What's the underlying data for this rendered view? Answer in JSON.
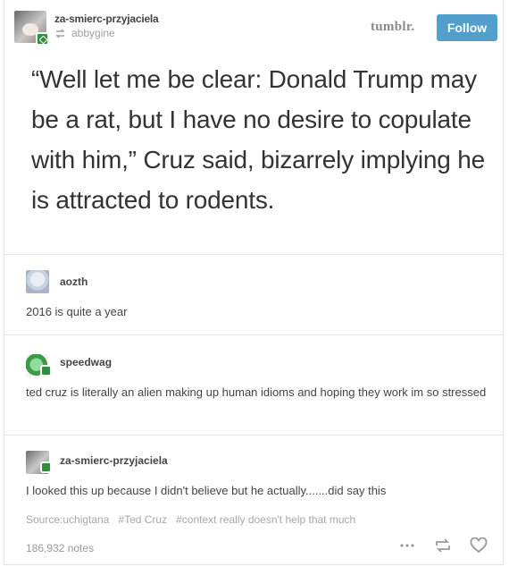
{
  "post": {
    "blog_name": "za-smierc-przyjaciela",
    "reblogged_from": "abbygine",
    "logo_text": "tumblr.",
    "follow_label": "Follow",
    "quote": "“Well let me be clear: Donald Trump may be a rat, but I have no desire to copulate with him,” Cruz said, bizarrely implying he is attracted to rodents."
  },
  "comments": [
    {
      "user": "aozth",
      "text": "2016 is quite a year"
    },
    {
      "user": "speedwag",
      "text": "ted cruz is literally an alien making up human idioms and hoping they work im so stressed"
    },
    {
      "user": "za-smierc-przyjaciela",
      "text": "I looked this up because I didn't believe but he actually.......did say this"
    }
  ],
  "tags": {
    "source": "Source:uchigtana",
    "tag1": "#Ted Cruz",
    "tag2": "#context really doesn't help that much"
  },
  "footer": {
    "notes": "186,932 notes",
    "icons": [
      "more-icon",
      "reblog-icon",
      "heart-icon"
    ]
  },
  "colors": {
    "accent": "#529ecc",
    "badge": "#2f8f3a"
  }
}
